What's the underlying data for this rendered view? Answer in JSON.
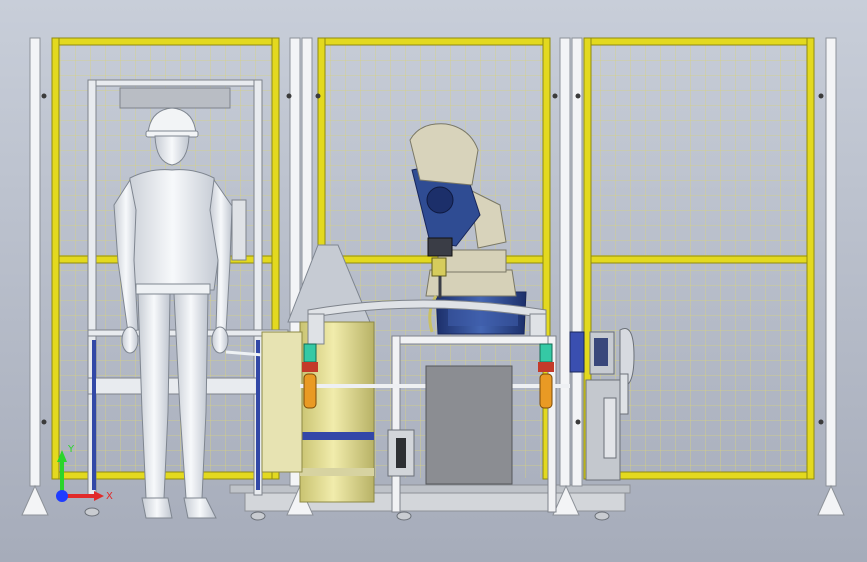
{
  "scene": {
    "subject": "robotic-welding-cell-cad-model",
    "view": "front-elevation"
  },
  "colors": {
    "background_top": "#c6ccd7",
    "background_bottom": "#a9afbd",
    "fence_yellow": "#e3d91f",
    "fence_grid": "#d9d47a",
    "fence_post": "#f3f4f6",
    "mannequin": "#e9edf2",
    "robot_blue": "#2e4b93",
    "robot_base": "#d8d2b8",
    "tank_yellow": "#e4df93",
    "gray_box": "#8b8d92",
    "torch_orange": "#e99a24",
    "green_fitting": "#35c9a5"
  },
  "axis_triad": {
    "x_label": "X",
    "y_label": "Y",
    "x_color": "#e12a2a",
    "y_color": "#2bd52b",
    "z_color": "#1f3cff"
  },
  "icons": [
    "safety-fence-panel",
    "operator-mannequin",
    "industrial-robot",
    "welding-positioner",
    "axis-triad"
  ]
}
